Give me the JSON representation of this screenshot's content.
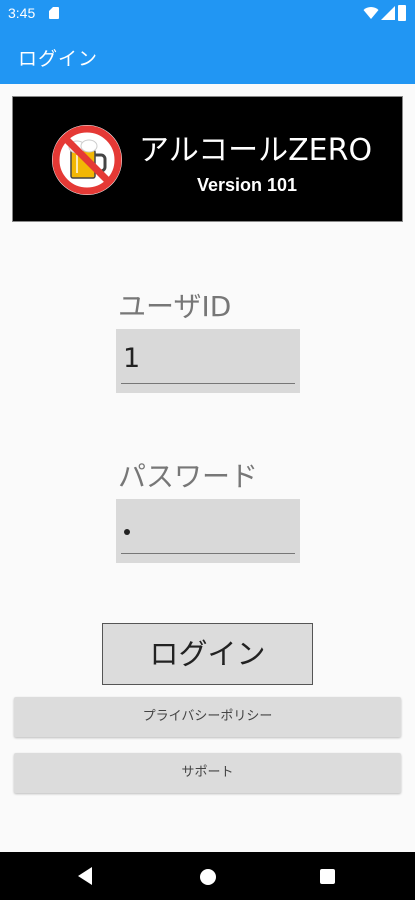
{
  "status_bar": {
    "time": "3:45",
    "icons": [
      "sd-card-icon",
      "wifi-icon",
      "signal-icon",
      "battery-icon"
    ]
  },
  "app_bar": {
    "title": "ログイン"
  },
  "banner": {
    "logo_icon": "no-beer-icon",
    "title": "アルコールZERO",
    "version": "Version 101"
  },
  "form": {
    "user_id": {
      "label": "ユーザID",
      "value": "1"
    },
    "password": {
      "label": "パスワード",
      "masked_length": 1
    }
  },
  "buttons": {
    "login": "ログイン",
    "privacy_policy": "プライバシーポリシー",
    "support": "サポート"
  },
  "nav_bar": {
    "icons": [
      "back-icon",
      "home-icon",
      "recents-icon"
    ]
  },
  "colors": {
    "primary": "#2196f3",
    "banner_bg": "#000000",
    "button_bg": "#dcdcdc",
    "nav_bg": "#000000"
  }
}
